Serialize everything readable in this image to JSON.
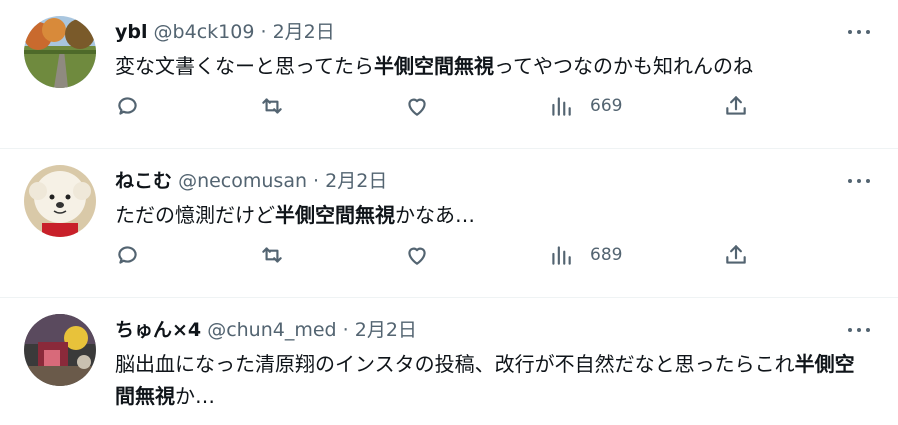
{
  "tweets": [
    {
      "display_name": "ybl",
      "handle": "@b4ck109",
      "separator": "·",
      "date": "2月2日",
      "text_before": "変な文書くなーと思ってたら",
      "text_bold": "半側空間無視",
      "text_after": "ってやつなのかも知れんのね",
      "views": "669",
      "avatar_icon": "avatar-park-path-photo"
    },
    {
      "display_name": "ねこむ",
      "handle": "@necomusan",
      "separator": "·",
      "date": "2月2日",
      "text_before": "ただの憶測だけど",
      "text_bold": "半側空間無視",
      "text_after": "かなあ…",
      "views": "689",
      "avatar_icon": "avatar-plush-dog"
    },
    {
      "display_name": "ちゅん×4",
      "handle": "@chun4_med",
      "separator": "·",
      "date": "2月2日",
      "text_before": "脳出血になった清原翔のインスタの投稿、改行が不自然だなと思ったらこれ",
      "text_bold": "半側空間無視",
      "text_after": "か…",
      "views": "",
      "avatar_icon": "avatar-figurine-photo"
    }
  ],
  "icons": {
    "reply": "reply-icon",
    "retweet": "retweet-icon",
    "like": "like-icon",
    "views": "views-icon",
    "share": "share-icon",
    "more": "more-icon"
  },
  "colors": {
    "text": "#0f1419",
    "secondary": "#536471",
    "divider": "#eff3f4"
  }
}
